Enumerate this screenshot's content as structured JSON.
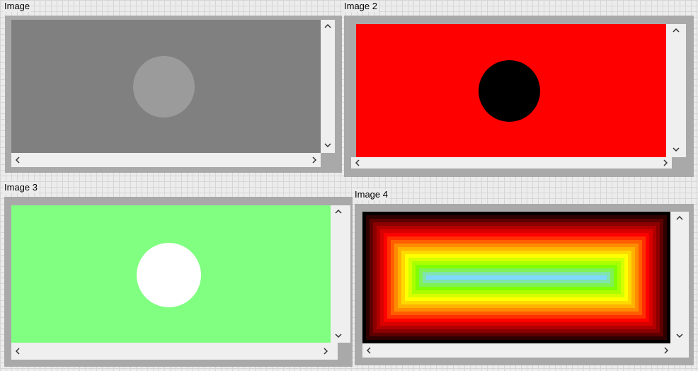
{
  "panels": [
    {
      "title": "Image",
      "background": "#808080",
      "circle_color": "#9b9b9b"
    },
    {
      "title": "Image 2",
      "background": "#ff0000",
      "circle_color": "#000000"
    },
    {
      "title": "Image 3",
      "background": "#80ff80",
      "circle_color": "#ffffff"
    },
    {
      "title": "Image 4",
      "gradient": [
        "#000000",
        "#8b0000",
        "#ff0000",
        "#ff8c00",
        "#ffff00",
        "#80ff00",
        "#7fd8ff",
        "#efefef"
      ]
    }
  ],
  "icons": {
    "scroll_up": "chevron-up-icon",
    "scroll_down": "chevron-down-icon",
    "scroll_left": "chevron-left-icon",
    "scroll_right": "chevron-right-icon"
  }
}
